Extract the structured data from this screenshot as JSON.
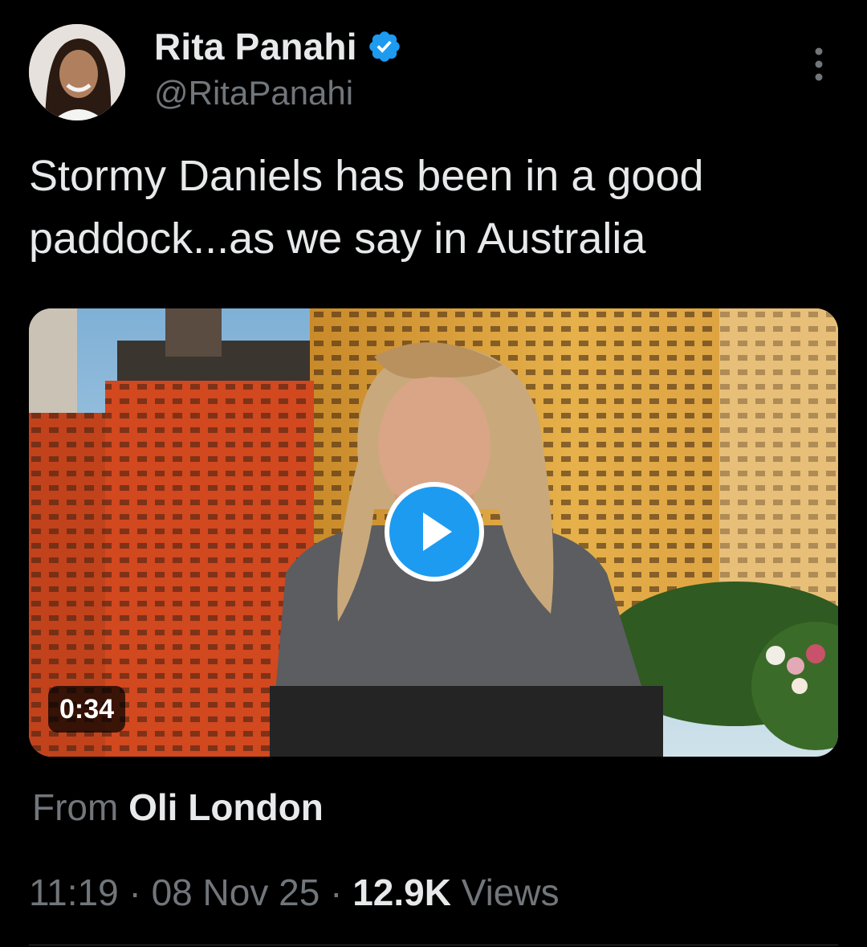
{
  "author": {
    "display_name": "Rita Panahi",
    "handle": "@RitaPanahi",
    "verified": true,
    "verified_color": "#1d9bf0"
  },
  "tweet": {
    "text": "Stormy Daniels has been in a good paddock...as we say in Australia"
  },
  "media": {
    "type": "video",
    "duration": "0:34",
    "play_icon": "play-icon"
  },
  "source": {
    "prefix": "From",
    "name": "Oli London"
  },
  "meta": {
    "time": "11:19",
    "separator": "·",
    "date": "08 Nov 25",
    "views_count": "12.9K",
    "views_label": "Views"
  },
  "icons": {
    "more": "more-vertical-icon",
    "verified": "verified-badge-icon"
  },
  "colors": {
    "background": "#000000",
    "text_primary": "#e7e9ea",
    "text_secondary": "#71767b",
    "accent": "#1d9bf0"
  }
}
